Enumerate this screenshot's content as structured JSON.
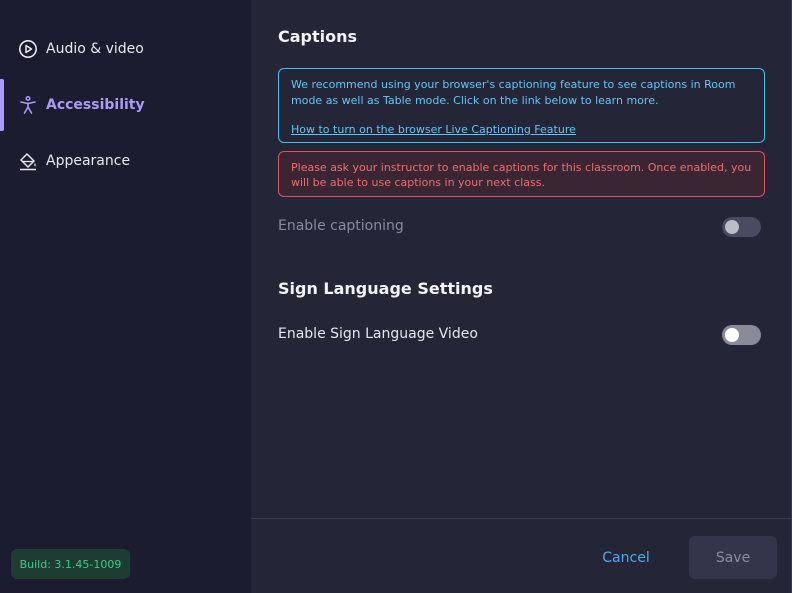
{
  "sidebar": {
    "items": [
      {
        "label": "Audio & video",
        "icon": "play-circle-icon"
      },
      {
        "label": "Accessibility",
        "icon": "accessibility-icon",
        "active": true
      },
      {
        "label": "Appearance",
        "icon": "paint-bucket-icon"
      }
    ],
    "build": "Build: 3.1.45-1009"
  },
  "captions": {
    "title": "Captions",
    "info_text": "We recommend using your browser's captioning feature to see captions in Room mode as well as Table mode. Click on the link below to learn more.",
    "info_link": "How to turn on the browser Live Captioning Feature",
    "warning_text": "Please ask your instructor to enable captions for this classroom. Once enabled, you will be able to use captions in your next class.",
    "enable_label": "Enable captioning",
    "enable_state": "off"
  },
  "sign_language": {
    "title": "Sign Language Settings",
    "enable_label": "Enable Sign Language Video",
    "enable_state": "off"
  },
  "footer": {
    "cancel_label": "Cancel",
    "save_label": "Save"
  },
  "colors": {
    "accent": "#a99cf5",
    "info": "#5ec8f4",
    "warning": "#f06b74",
    "build": "#3ec98a",
    "link": "#4ea9f0"
  }
}
